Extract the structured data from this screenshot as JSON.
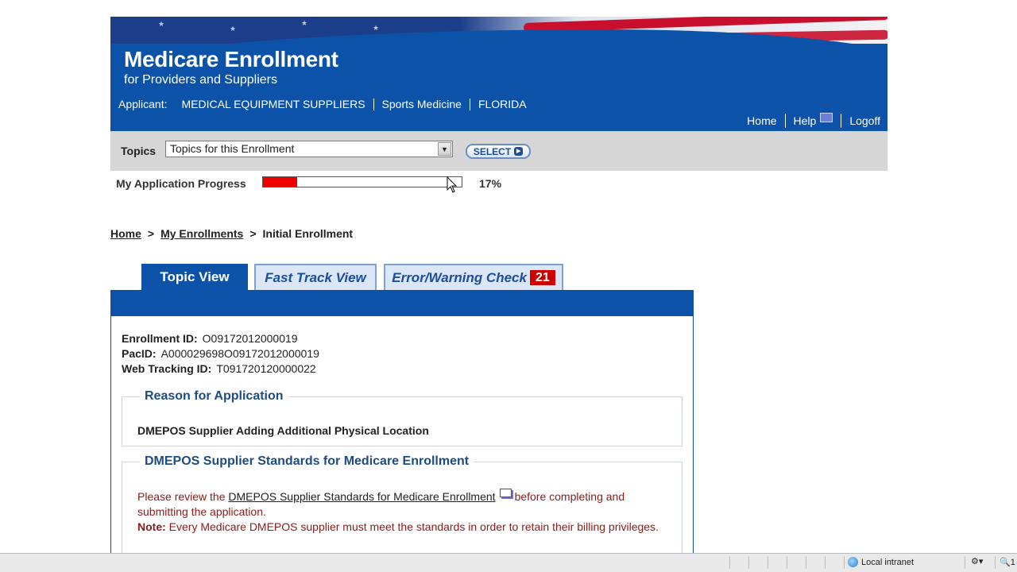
{
  "header": {
    "title": "Medicare Enrollment",
    "subtitle": "for Providers and Suppliers",
    "applicant_label": "Applicant:",
    "applicant_type": "MEDICAL EQUIPMENT SUPPLIERS",
    "specialty": "Sports Medicine",
    "state": "FLORIDA",
    "nav": {
      "home": "Home",
      "help": "Help",
      "logoff": "Logoff"
    }
  },
  "topics": {
    "label": "Topics",
    "selected": "Topics for this Enrollment",
    "select_button": "SELECT"
  },
  "progress": {
    "label": "My Application Progress",
    "percent_text": "17%",
    "value": 0.17
  },
  "breadcrumb": {
    "home": "Home",
    "sep": ">",
    "my_enrollments": "My Enrollments",
    "current": "Initial Enrollment"
  },
  "tabs": {
    "topic_view": "Topic View",
    "fast_track": "Fast Track View",
    "error_check": "Error/Warning Check",
    "error_count": "21"
  },
  "enrollment": {
    "enrollment_id_label": "Enrollment ID:",
    "enrollment_id": "O09172012000019",
    "pac_id_label": "PacID:",
    "pac_id": "A000029698O09172012000019",
    "tracking_id_label": "Web Tracking ID:",
    "tracking_id": "T091720120000022"
  },
  "reason": {
    "title": "Reason for Application",
    "text": "DMEPOS Supplier Adding Additional Physical Location"
  },
  "standards": {
    "title": "DMEPOS Supplier Standards for Medicare Enrollment",
    "intro": "Please review the",
    "link": "DMEPOS Supplier Standards for Medicare Enrollment",
    "after_link": "before completing and submitting the application.",
    "note_label": "Note:",
    "note_text": "Every Medicare DMEPOS supplier must meet the standards in order to retain their billing privileges."
  },
  "statusbar": {
    "zone": "Local intranet",
    "zoom": "1"
  },
  "colors": {
    "brand_blue": "#0c52a8",
    "progress_red": "#ee0000",
    "error_badge": "#cc0000",
    "note_text": "#8b1a1a"
  }
}
